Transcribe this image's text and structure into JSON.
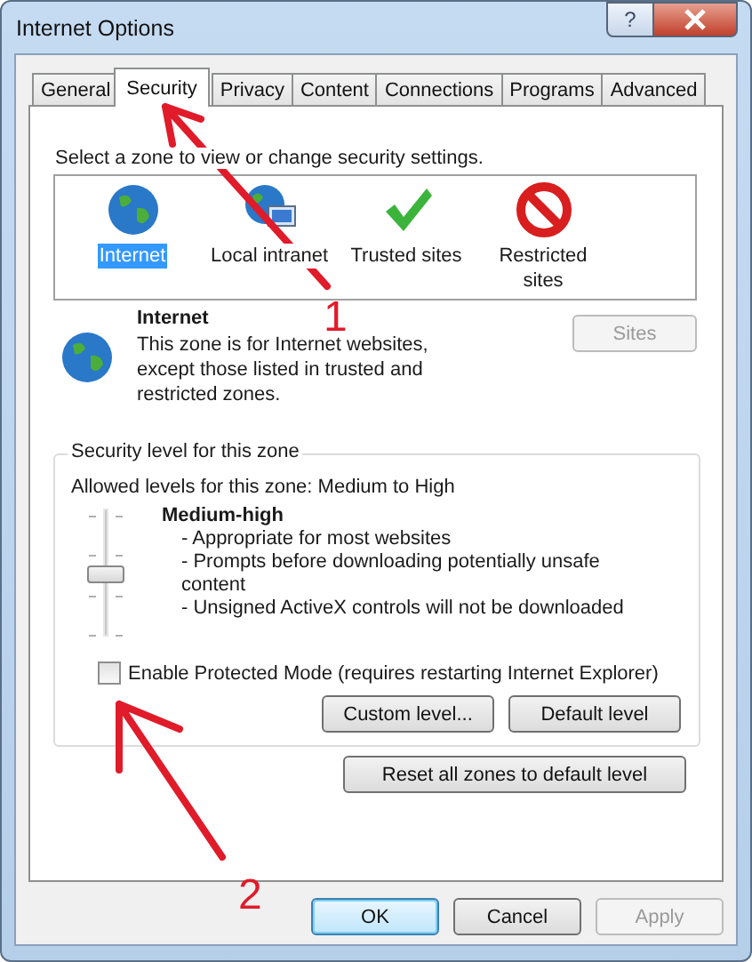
{
  "window": {
    "title": "Internet Options",
    "help_label": "?"
  },
  "tabs": [
    {
      "label": "General",
      "selected": false
    },
    {
      "label": "Security",
      "selected": true
    },
    {
      "label": "Privacy",
      "selected": false
    },
    {
      "label": "Content",
      "selected": false
    },
    {
      "label": "Connections",
      "selected": false
    },
    {
      "label": "Programs",
      "selected": false
    },
    {
      "label": "Advanced",
      "selected": false
    }
  ],
  "zone_prompt": "Select a zone to view or change security settings.",
  "zones": [
    {
      "label": "Internet",
      "kind": "internet",
      "selected": true
    },
    {
      "label": "Local intranet",
      "kind": "intranet",
      "selected": false
    },
    {
      "label": "Trusted sites",
      "kind": "trusted",
      "selected": false
    },
    {
      "label": "Restricted sites",
      "kind": "restricted",
      "selected": false
    }
  ],
  "zone_info": {
    "title": "Internet",
    "description": "This zone is for Internet websites, except those listed in trusted and restricted zones.",
    "sites_button": {
      "label": "Sites",
      "disabled": true
    }
  },
  "security_level": {
    "legend": "Security level for this zone",
    "allowed": "Allowed levels for this zone: Medium to High",
    "level": 0.5,
    "name": "Medium-high",
    "points": [
      "- Appropriate for most websites",
      "- Prompts before downloading potentially unsafe content",
      "- Unsigned ActiveX controls will not be downloaded"
    ],
    "protected_mode": {
      "label": "Enable Protected Mode (requires restarting Internet Explorer)",
      "checked": false
    },
    "buttons": [
      "Custom level...",
      "Default level"
    ]
  },
  "reset_button": "Reset all zones to default level",
  "dialog_buttons": [
    {
      "label": "OK",
      "default": true,
      "disabled": false
    },
    {
      "label": "Cancel",
      "default": false,
      "disabled": false
    },
    {
      "label": "Apply",
      "default": false,
      "disabled": true
    }
  ],
  "annotations": [
    {
      "label": "1"
    },
    {
      "label": "2"
    }
  ]
}
